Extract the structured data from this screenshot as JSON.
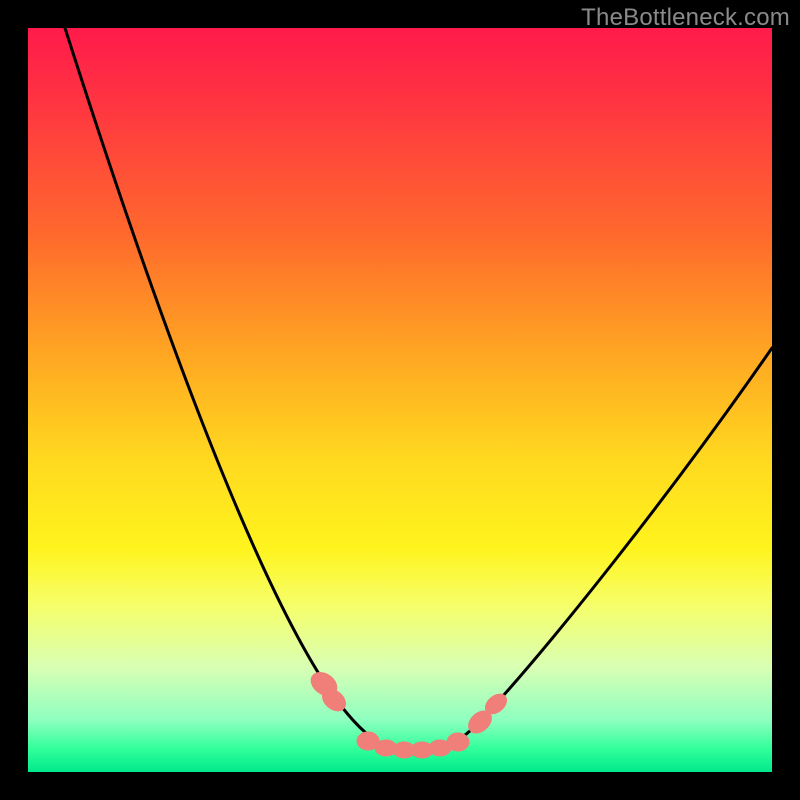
{
  "watermark": "TheBottleneck.com",
  "chart_data": {
    "type": "line",
    "title": "",
    "xlabel": "",
    "ylabel": "",
    "xlim": [
      0,
      100
    ],
    "ylim": [
      0,
      100
    ],
    "series": [
      {
        "name": "bottleneck-curve",
        "x": [
          5,
          10,
          15,
          20,
          25,
          30,
          35,
          40,
          44,
          48,
          50,
          52,
          54,
          56,
          60,
          65,
          70,
          75,
          80,
          85,
          90,
          95,
          100
        ],
        "y": [
          100,
          88,
          76,
          64,
          52,
          40,
          28,
          16,
          8,
          4,
          3,
          3,
          3,
          4,
          7,
          12,
          18,
          24,
          30,
          37,
          44,
          51,
          58
        ]
      }
    ],
    "highlight": {
      "name": "optimal-range-markers",
      "x": [
        40,
        42,
        47,
        49,
        51,
        53,
        55,
        57,
        60,
        62
      ],
      "y": [
        11,
        9,
        4,
        3.5,
        3.3,
        3.3,
        3.5,
        4,
        6,
        8
      ]
    },
    "colors": {
      "gradient_top": "#ff1a4b",
      "gradient_bottom": "#00e98b",
      "curve": "#000000",
      "marker": "#ef7f78"
    }
  }
}
